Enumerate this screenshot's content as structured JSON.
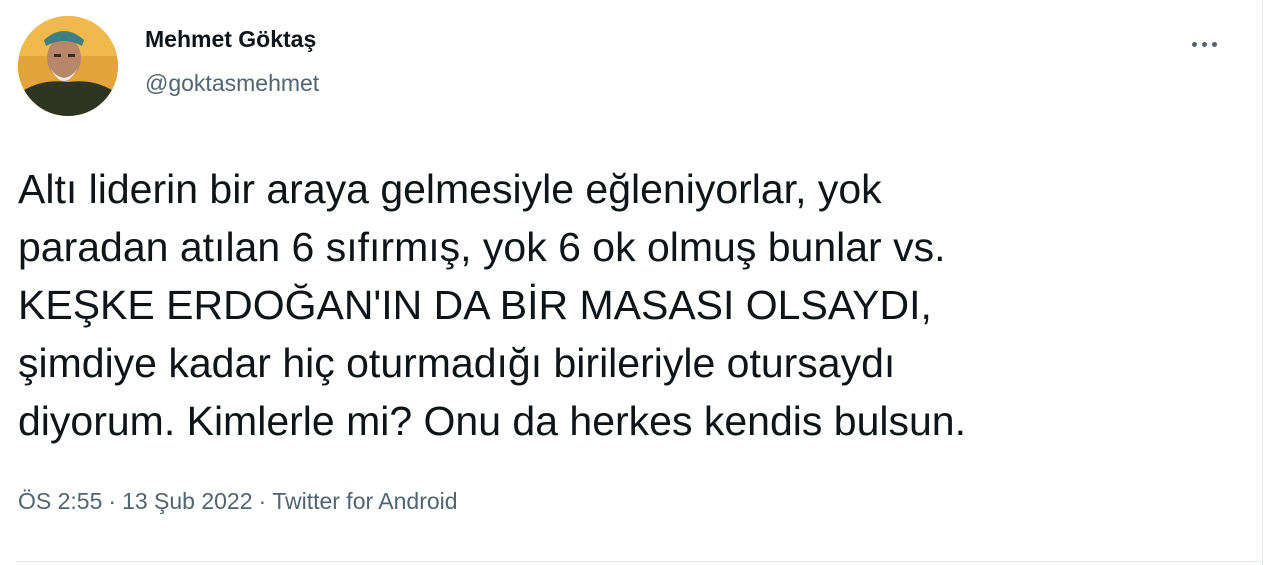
{
  "author": {
    "name": "Mehmet Göktaş",
    "handle": "@goktasmehmet"
  },
  "menu": {
    "icon": "more-horizontal-icon"
  },
  "tweet": {
    "lines": [
      "Altı liderin bir araya gelmesiyle eğleniyorlar, yok",
      "paradan atılan 6 sıfırmış, yok 6 ok olmuş bunlar vs.",
      "KEŞKE ERDOĞAN'IN DA BİR MASASI OLSAYDI,",
      "şimdiye kadar hiç oturmadığı birileriyle otursaydı",
      "diyorum. Kimlerle mi? Onu da herkes kendis bulsun."
    ]
  },
  "meta": {
    "time": "ÖS 2:55",
    "separator": "·",
    "date": "13 Şub 2022",
    "source": "Twitter for Android"
  },
  "colors": {
    "text": "#0f1419",
    "secondary": "#536471",
    "divider": "#e6ecf0",
    "avatar_bg": "#e8a73a"
  }
}
